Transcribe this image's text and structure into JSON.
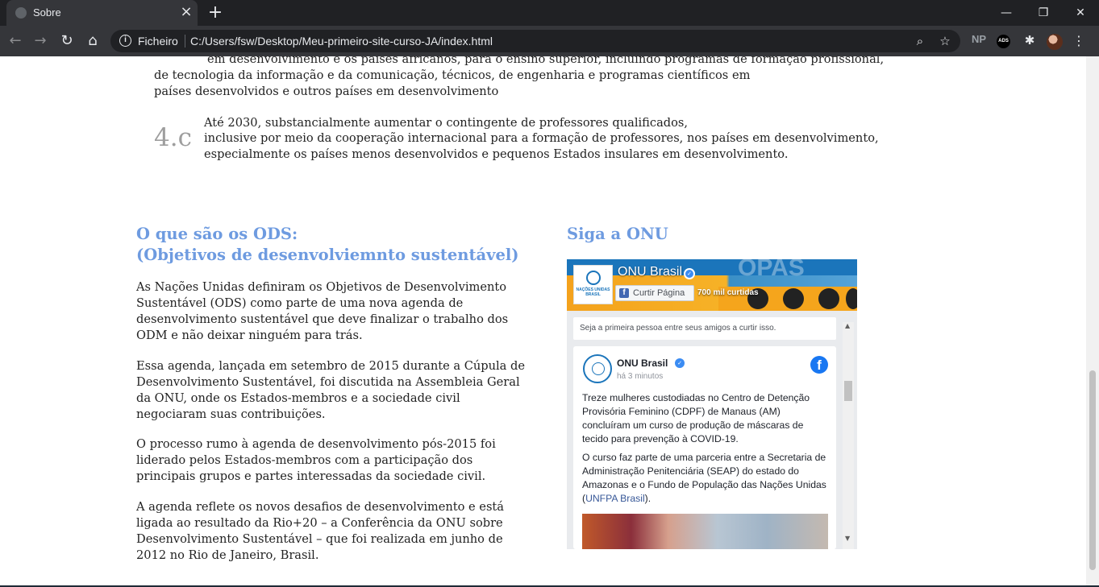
{
  "browser": {
    "tab_title": "Sobre",
    "address_scheme": "Ficheiro",
    "address_url": "C:/Users/fsw/Desktop/Meu-primeiro-site-curso-JA/index.html",
    "extensions": {
      "np": "NP",
      "ads": "ADS"
    },
    "icons": [
      "back-icon",
      "forward-icon",
      "reload-icon",
      "home-icon",
      "info-icon",
      "zoom-icon",
      "star-icon",
      "puzzle-icon",
      "menu-dots-icon"
    ]
  },
  "targets": {
    "b_line1": "em desenvolvimento e os países africanos, para o ensino superior, incluindo programas de formação profissional,",
    "b_line2": "de tecnologia da informação e da comunicação, técnicos, de engenharia e programas científicos em",
    "b_line3": "países desenvolvidos e outros países em desenvolvimento",
    "c_number": "4.c",
    "c_line1": "Até 2030, substancialmente aumentar o contingente de professores qualificados,",
    "c_line2": "inclusive por meio da cooperação internacional para a formação de professores, nos países em desenvolvimento,",
    "c_line3": "especialmente os países menos desenvolvidos e pequenos Estados insulares em desenvolvimento."
  },
  "ods": {
    "title_line1": "O que são os ODS:",
    "title_line2": "(Objetivos de desenvolviemnto sustentável)",
    "paragraphs": [
      "As Nações Unidas definiram os Objetivos de Desenvolvimento Sustentável (ODS) como parte de uma nova agenda de desenvolvimento sustentável que deve finalizar o trabalho dos ODM e não deixar ninguém para trás.",
      "Essa agenda, lançada em setembro de 2015 durante a Cúpula de Desenvolvimento Sustentável, foi discutida na Assembleia Geral da ONU, onde os Estados-membros e a sociedade civil negociaram suas contribuições.",
      "O processo rumo à agenda de desenvolvimento pós-2015 foi liderado pelos Estados-membros com a participação dos principais grupos e partes interessadas da sociedade civil.",
      "A agenda reflete os novos desafios de desenvolvimento e está ligada ao resultado da Rio+20 – a Conferência da ONU sobre Desenvolvimento Sustentável – que foi realizada em junho de 2012 no Rio de Janeiro, Brasil."
    ]
  },
  "onu": {
    "title": "Siga a ONU",
    "cover_text": "OPAS",
    "page_name": "ONU Brasil",
    "logo_text": "NAÇÕES UNIDAS BRASIL",
    "like_button": "Curtir Página",
    "likes_count": "700 mil curtidas",
    "friends_text": "Seja a primeira pessoa entre seus amigos a curtir isso.",
    "post": {
      "author": "ONU Brasil",
      "time": "há 3 minutos",
      "text1": "Treze mulheres custodiadas no Centro de Detenção Provisória Feminino (CDPF) de Manaus (AM) concluíram um curso de produção de máscaras de tecido para prevenção à COVID-19.",
      "text2_before": "O curso faz parte de uma parceria entre a Secretaria de Administração Penitenciária (SEAP) do estado do Amazonas e o Fundo de População das Nações Unidas (",
      "text2_link": "UNFPA Brasil",
      "text2_after": ")."
    }
  },
  "colors": {
    "heading": "#6e9be0",
    "body_text": "#222222",
    "target_number": "#9e9e9e",
    "facebook_blue": "#1877f2"
  }
}
